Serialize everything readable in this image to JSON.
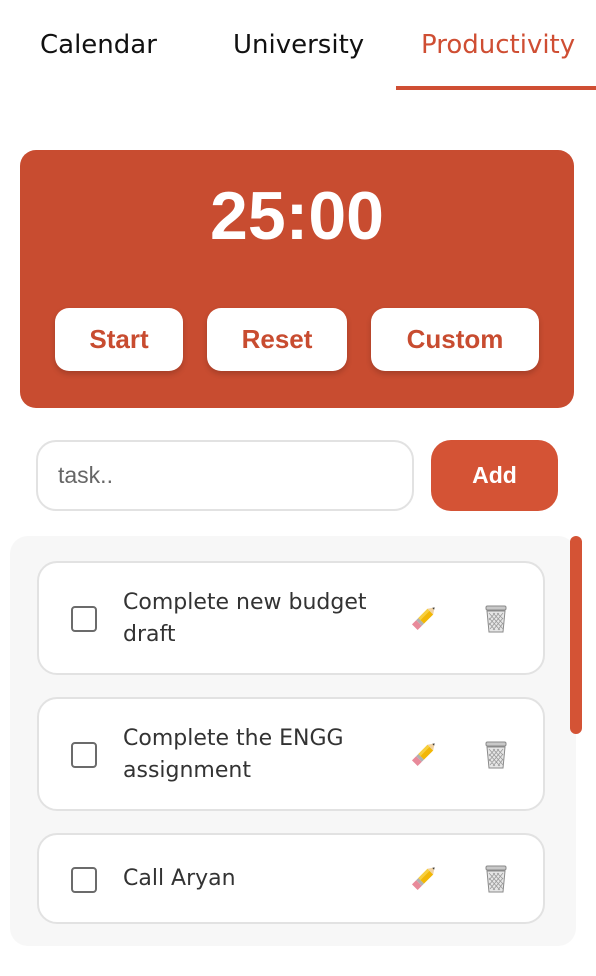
{
  "tabs": {
    "calendar": "Calendar",
    "university": "University",
    "productivity": "Productivity",
    "active": "Productivity"
  },
  "timer": {
    "display": "25:00",
    "start_label": "Start",
    "reset_label": "Reset",
    "custom_label": "Custom"
  },
  "task_input": {
    "placeholder": "task..",
    "value": "",
    "add_label": "Add"
  },
  "tasks": [
    {
      "text": "Complete new budget draft",
      "done": false
    },
    {
      "text": "Complete the ENGG assignment",
      "done": false
    },
    {
      "text": "Call Aryan",
      "done": false
    }
  ],
  "icons": {
    "edit": "pencil-icon",
    "delete": "trash-icon"
  },
  "colors": {
    "accent": "#c84c30",
    "add_button": "#d45335",
    "active_tab": "#cf4e33"
  }
}
